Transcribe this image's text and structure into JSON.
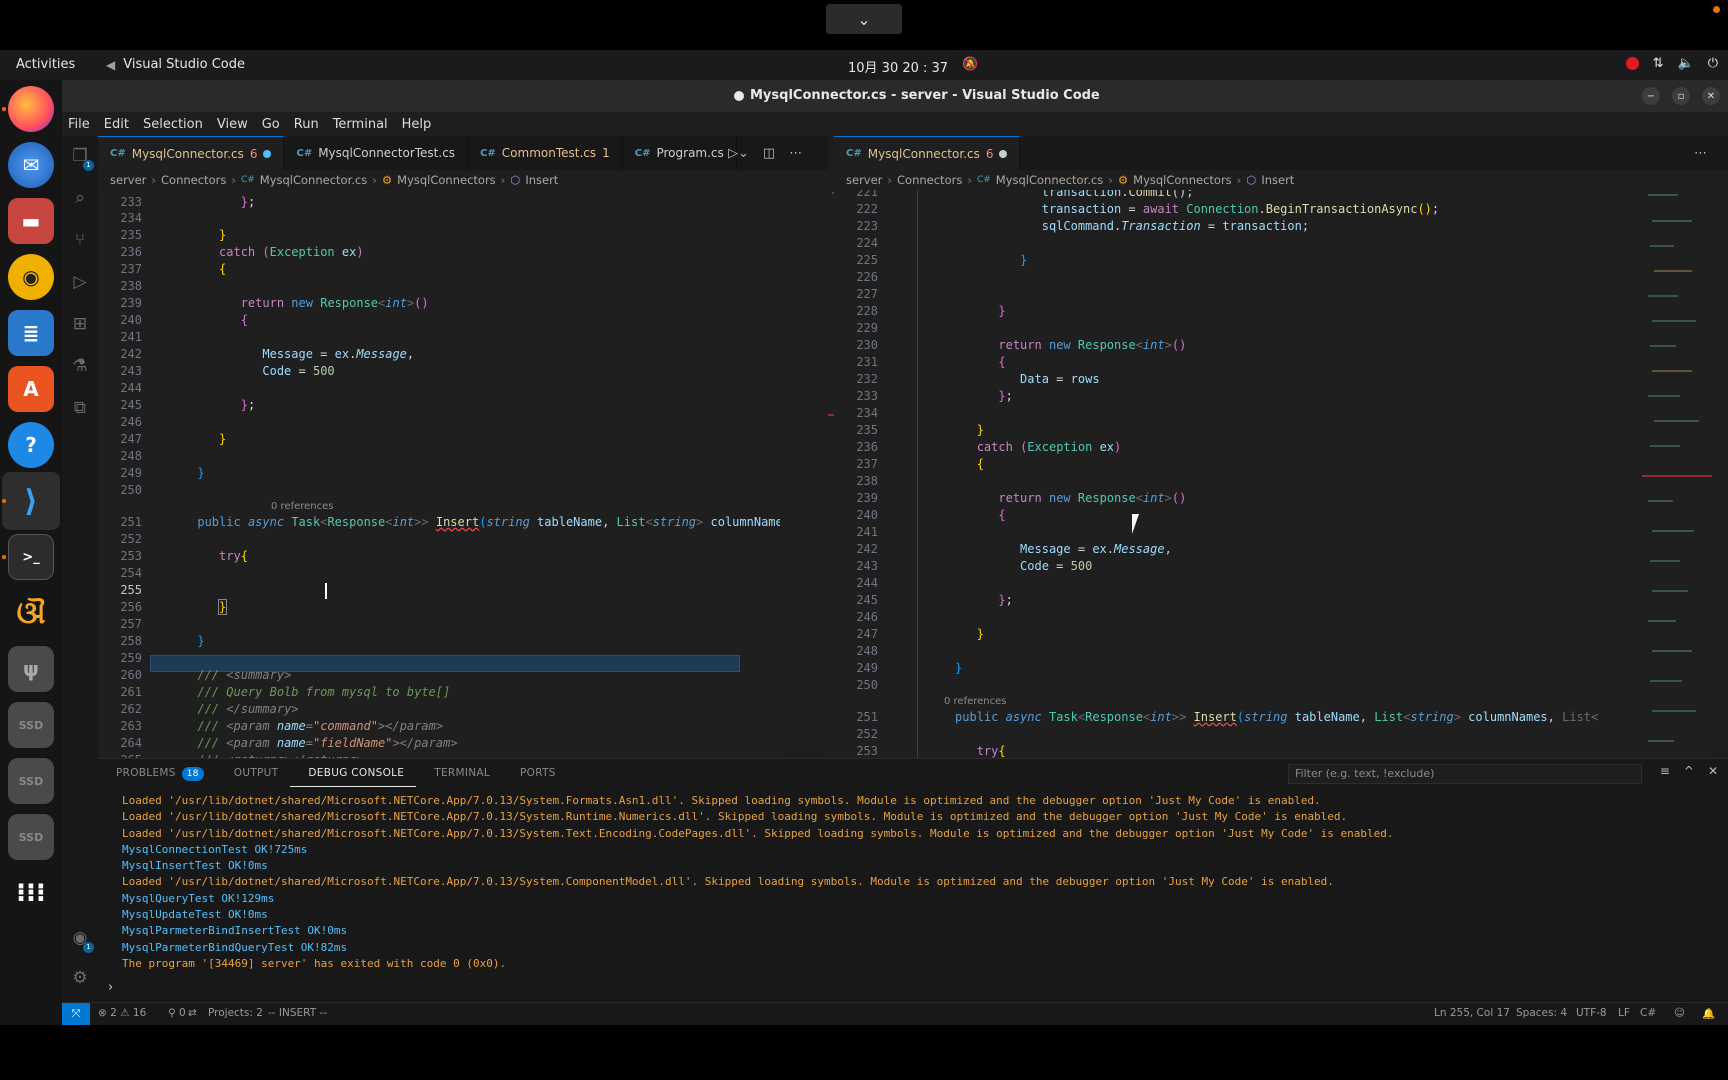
{
  "system": {
    "activities": "Activities",
    "app_name": "Visual Studio Code",
    "clock": "10月 30  20 : 37"
  },
  "window": {
    "title": "MysqlConnector.cs - server - Visual Studio Code"
  },
  "menu": [
    "File",
    "Edit",
    "Selection",
    "View",
    "Go",
    "Run",
    "Terminal",
    "Help"
  ],
  "left_editor": {
    "tabs": [
      {
        "label": "MysqlConnector.cs",
        "badge": "6",
        "active": true,
        "dirty": true
      },
      {
        "label": "MysqlConnectorTest.cs",
        "badge": "",
        "active": false,
        "dirty": false
      },
      {
        "label": "CommonTest.cs",
        "badge": "1",
        "active": false,
        "dirty": false
      },
      {
        "label": "Program.cs",
        "badge": "",
        "active": false,
        "dirty": false
      }
    ],
    "breadcrumb": [
      "server",
      "Connectors",
      "MysqlConnector.cs",
      "MysqlConnectors",
      "Insert"
    ],
    "codelens": "0 references",
    "current_line": "255"
  },
  "right_editor": {
    "tabs": [
      {
        "label": "MysqlConnector.cs",
        "badge": "6",
        "active": true,
        "dirty": true
      }
    ],
    "breadcrumb": [
      "server",
      "Connectors",
      "MysqlConnector.cs",
      "MysqlConnectors",
      "Insert"
    ],
    "codelens": "0 references"
  },
  "panel": {
    "tabs": [
      {
        "label": "PROBLEMS",
        "badge": "18"
      },
      {
        "label": "OUTPUT",
        "badge": ""
      },
      {
        "label": "DEBUG CONSOLE",
        "badge": ""
      },
      {
        "label": "TERMINAL",
        "badge": ""
      },
      {
        "label": "PORTS",
        "badge": ""
      }
    ],
    "active_tab": "DEBUG CONSOLE",
    "filter_placeholder": "Filter (e.g. text, !exclude)",
    "console": [
      {
        "text": "Loaded '/usr/lib/dotnet/shared/Microsoft.NETCore.App/7.0.13/System.Formats.Asn1.dll'. Skipped loading symbols. Module is optimized and the debugger option 'Just My Code' is enabled.",
        "kind": "orange"
      },
      {
        "text": "Loaded '/usr/lib/dotnet/shared/Microsoft.NETCore.App/7.0.13/System.Runtime.Numerics.dll'. Skipped loading symbols. Module is optimized and the debugger option 'Just My Code' is enabled.",
        "kind": "orange"
      },
      {
        "text": "Loaded '/usr/lib/dotnet/shared/Microsoft.NETCore.App/7.0.13/System.Text.Encoding.CodePages.dll'. Skipped loading symbols. Module is optimized and the debugger option 'Just My Code' is enabled.",
        "kind": "orange"
      },
      {
        "text": "MysqlConnectionTest OK!725ms",
        "kind": "blue"
      },
      {
        "text": "MysqlInsertTest OK!0ms",
        "kind": "blue"
      },
      {
        "text": "Loaded '/usr/lib/dotnet/shared/Microsoft.NETCore.App/7.0.13/System.ComponentModel.dll'. Skipped loading symbols. Module is optimized and the debugger option 'Just My Code' is enabled.",
        "kind": "orange"
      },
      {
        "text": "MysqlQueryTest OK!129ms",
        "kind": "blue"
      },
      {
        "text": "MysqlUpdateTest OK!0ms",
        "kind": "blue"
      },
      {
        "text": "MysqlParmeterBindInsertTest OK!0ms",
        "kind": "blue"
      },
      {
        "text": "MysqlParmeterBindQueryTest OK!82ms",
        "kind": "blue"
      },
      {
        "text": "The program '[34469] server' has exited with code 0 (0x0).",
        "kind": "orange"
      }
    ]
  },
  "status": {
    "errors": "2",
    "warnings": "16",
    "ports": "0",
    "projects": "Projects: 2",
    "mode": "-- INSERT --",
    "position": "Ln 255, Col 17",
    "spaces": "Spaces: 4",
    "encoding": "UTF-8",
    "eol": "LF",
    "language": "C#"
  },
  "dock_icons": [
    "firefox-icon",
    "thunderbird-icon",
    "files-icon",
    "rhythmbox-icon",
    "writer-icon",
    "app-center-icon",
    "help-icon",
    "vscode-icon",
    "terminal-icon",
    "octopus-icon",
    "usb-drive-icon",
    "ssd-drive-icon",
    "ssd-drive-icon",
    "ssd-drive-icon",
    "app-grid-icon"
  ],
  "colors": {
    "accent": "#0078d4",
    "console_orange": "#e9a23b",
    "console_blue": "#4fc1ff",
    "editor_bg": "#1f1f1f"
  }
}
